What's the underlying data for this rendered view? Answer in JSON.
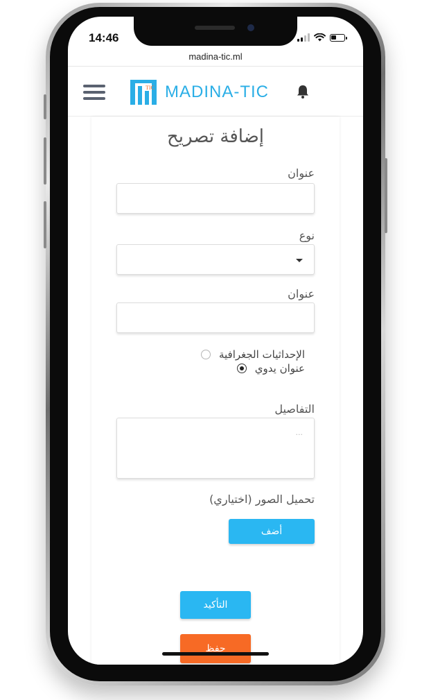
{
  "status_bar": {
    "time": "14:46"
  },
  "browser": {
    "url": "madina-tic.ml"
  },
  "header": {
    "brand": "MADINA-TIC",
    "logo_badge": "TIC"
  },
  "form": {
    "title": "إضافة تصريح",
    "title_field": {
      "label": "عنوان",
      "value": ""
    },
    "type_field": {
      "label": "نوع",
      "selected": ""
    },
    "address_field": {
      "label": "عنوان",
      "value": ""
    },
    "location_options": [
      {
        "label": "الإحداثيات الجغرافية",
        "selected": false
      },
      {
        "label": "عنوان يدوي",
        "selected": true
      }
    ],
    "details_field": {
      "label": "التفاصيل",
      "placeholder": "..."
    },
    "photos_label": "تحميل الصور (اختياري)",
    "add_button": "أضف",
    "confirm_button": "التأكيد",
    "save_button": "حفظ"
  },
  "colors": {
    "brand": "#2aaee6",
    "primary_button": "#2ab7f2",
    "save_button": "#f76a25"
  }
}
